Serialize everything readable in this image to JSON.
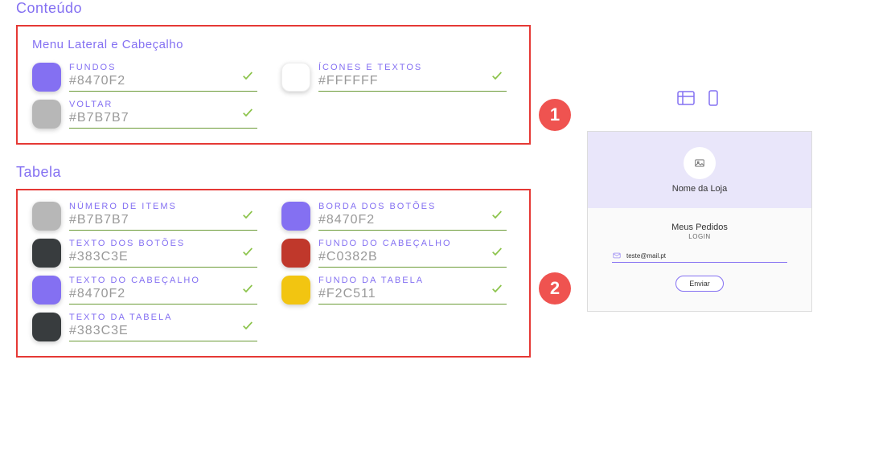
{
  "page_title": "Conteúdo",
  "sections": {
    "menu": {
      "title": "Menu Lateral e Cabeçalho",
      "badge": "1",
      "fields": [
        {
          "label": "FUNDOS",
          "value": "#8470F2",
          "swatch": "#8470F2"
        },
        {
          "label": "ÍCONES E TEXTOS",
          "value": "#FFFFFF",
          "swatch": "#FFFFFF"
        },
        {
          "label": "VOLTAR",
          "value": "#B7B7B7",
          "swatch": "#B7B7B7"
        }
      ]
    },
    "tabela": {
      "title": "Tabela",
      "badge": "2",
      "fields": [
        {
          "label": "NÚMERO DE ITEMS",
          "value": "#B7B7B7",
          "swatch": "#B7B7B7"
        },
        {
          "label": "BORDA DOS BOTÕES",
          "value": "#8470F2",
          "swatch": "#8470F2"
        },
        {
          "label": "TEXTO DOS BOTÕES",
          "value": "#383C3E",
          "swatch": "#383C3E"
        },
        {
          "label": "FUNDO DO CABEÇALHO",
          "value": "#C0382B",
          "swatch": "#C0382B"
        },
        {
          "label": "TEXTO DO CABEÇALHO",
          "value": "#8470F2",
          "swatch": "#8470F2"
        },
        {
          "label": "FUNDO DA TABELA",
          "value": "#F2C511",
          "swatch": "#F2C511"
        },
        {
          "label": "TEXTO DA TABELA",
          "value": "#383C3E",
          "swatch": "#383C3E"
        }
      ]
    }
  },
  "preview": {
    "store_name": "Nome da Loja",
    "body_title": "Meus Pedidos",
    "body_sub": "LOGIN",
    "input_value": "teste@mail.pt",
    "button": "Enviar"
  }
}
